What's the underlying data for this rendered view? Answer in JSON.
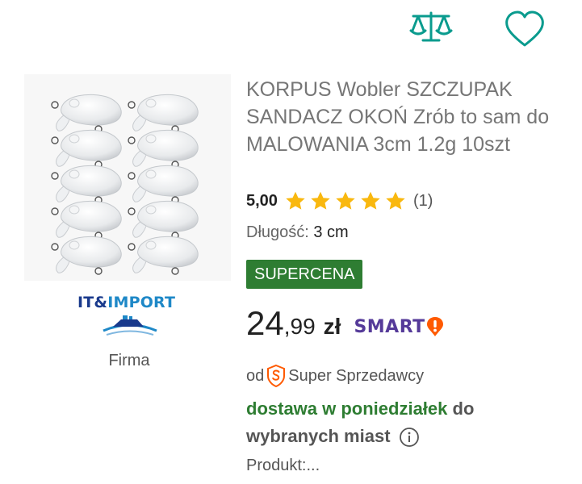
{
  "product": {
    "title": "KORPUS Wobler SZCZUPAK SANDACZ OKOŃ Zrób to sam do MALOWANIA 3cm 1.2g 10szt",
    "rating": {
      "value": "5,00",
      "stars": 5,
      "count": "(1)"
    },
    "parameter": {
      "label": "Długość:",
      "value": "3 cm"
    },
    "badge": "SUPERCENA",
    "price": {
      "main": "24",
      "cents": ",99",
      "currency": "zł"
    },
    "smart_label": "SMART",
    "seller_row": {
      "prefix": "od",
      "label": "Super Sprzedawcy"
    },
    "delivery": {
      "highlight": "dostawa w poniedziałek",
      "rest": "do wybranych miast"
    },
    "more": "Produkt:..."
  },
  "seller": {
    "logo_text_part1": "IT&",
    "logo_text_part2": "IMPORT",
    "label": "Firma"
  },
  "icons": {
    "compare": "scale-icon",
    "favorite": "heart-icon",
    "star": "star-icon",
    "smart": "smart-exclamation-icon",
    "super_seller": "super-seller-shield-icon",
    "info": "info-icon"
  },
  "colors": {
    "accent_teal": "#0a9b8e",
    "star_yellow": "#f9b80f",
    "badge_green": "#2e7d32",
    "smart_purple": "#553a99",
    "smart_orange": "#ff5a00",
    "title_gray": "#767676"
  }
}
